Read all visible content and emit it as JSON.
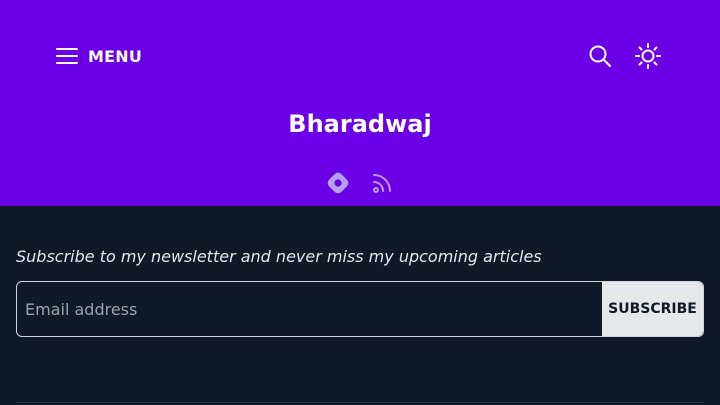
{
  "header": {
    "menu_label": "MENU",
    "title": "Bharadwaj",
    "icons": {
      "menu": "hamburger-icon",
      "search": "search-icon",
      "theme": "sun-icon",
      "hashnode": "hashnode-icon",
      "rss": "rss-icon"
    }
  },
  "newsletter": {
    "text": "Subscribe to my newsletter and never miss my upcoming articles",
    "email_placeholder": "Email address",
    "subscribe_label": "SUBSCRIBE"
  },
  "colors": {
    "brand": "#6b00e6",
    "background": "#111827",
    "button": "#e5e7eb"
  }
}
